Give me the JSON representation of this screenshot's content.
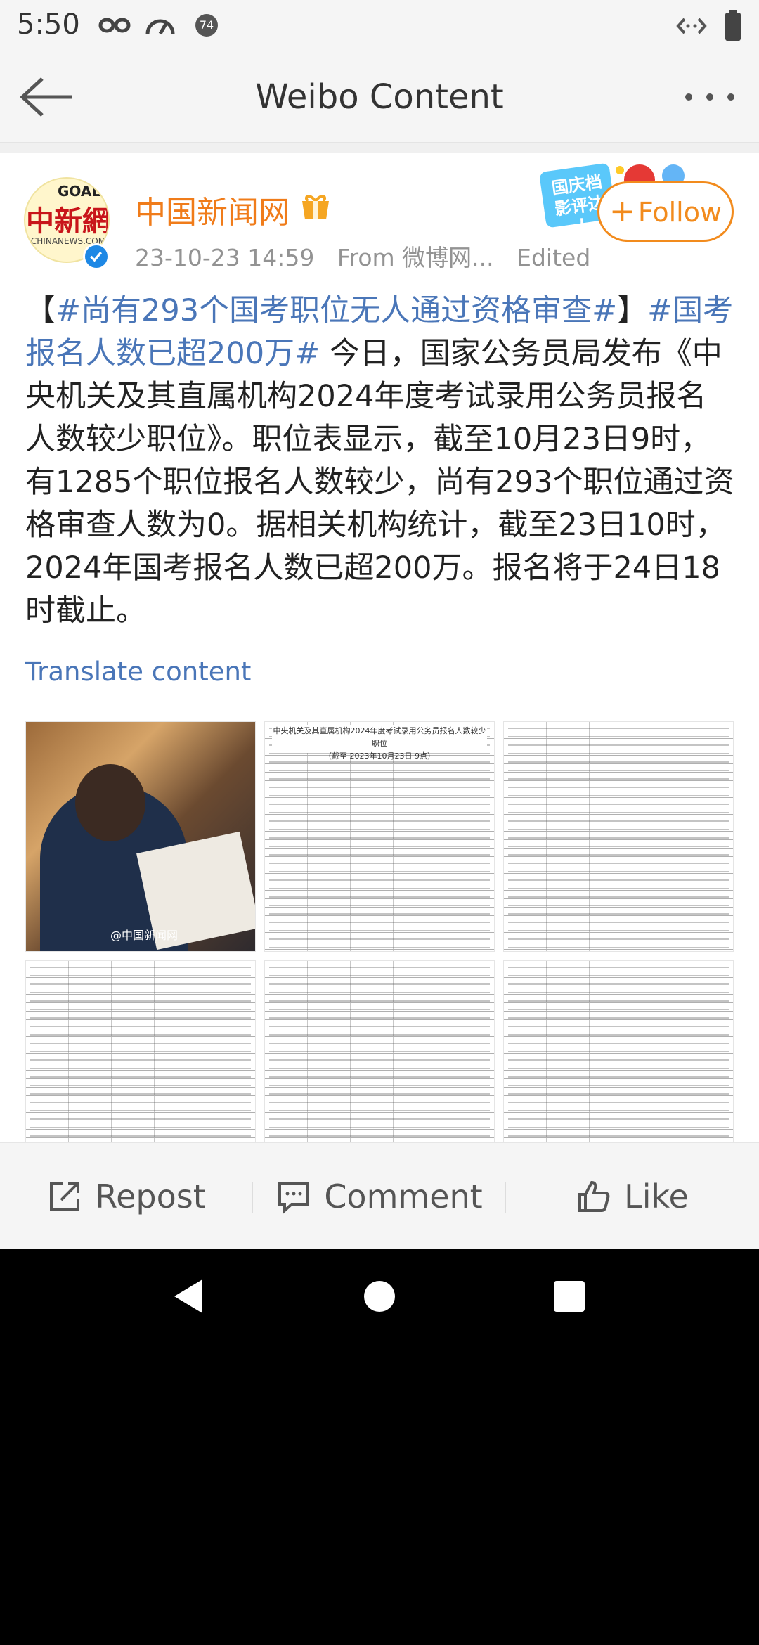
{
  "status_bar": {
    "time": "5:50",
    "notification_count": "74",
    "icons": [
      "infinity-icon",
      "speedometer-icon",
      "notification-count-icon",
      "code-icon",
      "battery-icon"
    ]
  },
  "nav": {
    "title": "Weibo Content",
    "back_icon": "arrow-left-icon",
    "more_icon": "more-dots-icon"
  },
  "post": {
    "author": "中国新闻网",
    "avatar_logo": "中新網",
    "avatar_top": "GOAL!",
    "avatar_sub": "CHINANEWS.COM",
    "badge_icon": "gift-badge-icon",
    "promo_label": "国庆档 影评达人",
    "follow_label": "Follow",
    "timestamp": "23-10-23 14:59",
    "source": "From 微博网...",
    "edited": "Edited",
    "body": {
      "open_bracket": "【",
      "tag1": "#尚有293个国考职位无人通过资格审查#",
      "close_bracket": "】",
      "tag2": "#国考报名人数已超200万#",
      "text": " 今日，国家公务员局发布《中央机关及其直属机构2024年度考试录用公务员报名人数较少职位》。职位表显示，截至10月23日9时，有1285个职位报名人数较少，尚有293个职位通过资格审查人数为0。据相关机构统计，截至23日10时，2024年国考报名人数已超200万。报名将于24日18时截止。"
    },
    "translate": "Translate content",
    "image_watermark": "@中国新闻网",
    "sheet_title": "中央机关及其直属机构2024年度考试录用公务员报名人数较少职位",
    "sheet_subtitle": "（截至 2023年10月23日 9点）"
  },
  "actions": {
    "repost": "Repost",
    "comment": "Comment",
    "like": "Like"
  },
  "colors": {
    "accent_orange": "#f28b1d",
    "link_blue": "#4a76b8",
    "name_orange": "#f07c1a"
  }
}
